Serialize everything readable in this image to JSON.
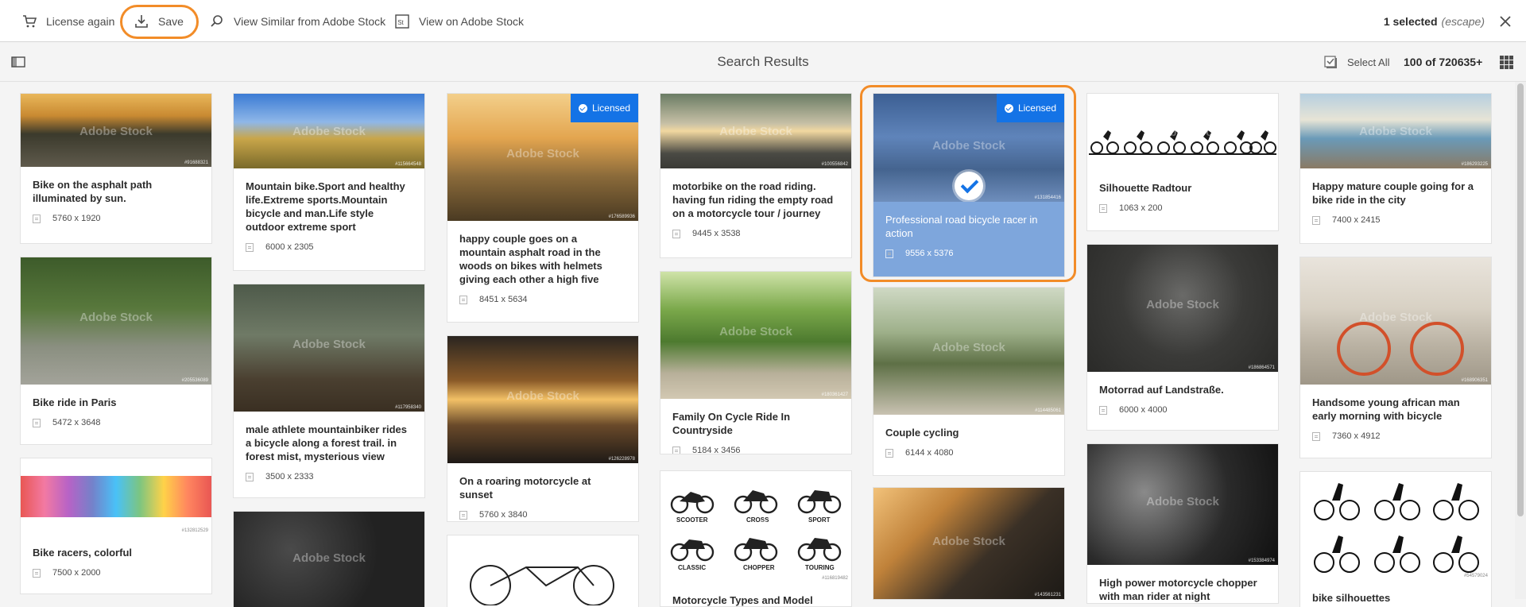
{
  "actions": {
    "license_again": "License again",
    "save": "Save",
    "view_similar": "View Similar from Adobe Stock",
    "view_on_stock": "View on Adobe Stock"
  },
  "selection": {
    "count_label": "1 selected",
    "hint": "(escape)"
  },
  "titlebar": {
    "title": "Search Results",
    "select_all": "Select All",
    "count": "100 of 720635+"
  },
  "watermark": "Adobe Stock",
  "licensed_label": "Licensed",
  "colors": {
    "accent": "#1473e6",
    "highlight": "#f28c28",
    "selected_card": "#7ea6dc"
  },
  "cards": [
    {
      "title": "Bike on the asphalt path illuminated by sun.",
      "size": "5760 x 1920",
      "id": "#91688321",
      "licensed": false,
      "selected": false
    },
    {
      "title": "Bike ride in Paris",
      "size": "5472 x 3648",
      "id": "#205536089",
      "licensed": false,
      "selected": false
    },
    {
      "title": "Bike racers, colorful",
      "size": "7500 x 2000",
      "id": "#132812529",
      "licensed": false,
      "selected": false
    },
    {
      "title": "Mountain bike.Sport and healthy life.Extreme sports.Mountain bicycle and man.Life style outdoor extreme sport",
      "size": "6000 x 2305",
      "id": "#115664548",
      "licensed": false,
      "selected": false
    },
    {
      "title": "male athlete mountainbiker rides a bicycle along a forest trail. in forest mist, mysterious view",
      "size": "3500 x 2333",
      "id": "#117958340",
      "licensed": false,
      "selected": false
    },
    {
      "title": "",
      "size": "",
      "id": "",
      "licensed": false,
      "selected": false
    },
    {
      "title": "happy couple goes on a mountain asphalt road in the woods on bikes with helmets giving each other a high five",
      "size": "8451 x 5634",
      "id": "#176589936",
      "licensed": true,
      "selected": false
    },
    {
      "title": "On a roaring motorcycle at sunset",
      "size": "5760 x 3840",
      "id": "#126228978",
      "licensed": false,
      "selected": false
    },
    {
      "title": "",
      "size": "",
      "id": "",
      "licensed": false,
      "selected": false
    },
    {
      "title": "motorbike on the road riding. having fun riding the empty road on a motorcycle tour / journey",
      "size": "9445 x 3538",
      "id": "#100556842",
      "licensed": false,
      "selected": false
    },
    {
      "title": "Family On Cycle Ride In Countryside",
      "size": "5184 x 3456",
      "id": "#180361427",
      "licensed": false,
      "selected": false
    },
    {
      "title": "Motorcycle Types and Model Objects",
      "size": "",
      "id": "#116819482",
      "licensed": false,
      "selected": false
    },
    {
      "title": "Professional road bicycle racer in action",
      "size": "9556 x 5376",
      "id": "#131854416",
      "licensed": true,
      "selected": true
    },
    {
      "title": "Couple cycling",
      "size": "6144 x 4080",
      "id": "#114485061",
      "licensed": false,
      "selected": false
    },
    {
      "title": "",
      "size": "",
      "id": "#143561231",
      "licensed": false,
      "selected": false
    },
    {
      "title": "Silhouette Radtour",
      "size": "1063 x 200",
      "id": "",
      "licensed": false,
      "selected": false
    },
    {
      "title": "Motorrad auf Landstraße.",
      "size": "6000 x 4000",
      "id": "#186864571",
      "licensed": false,
      "selected": false
    },
    {
      "title": "High power motorcycle chopper with man rider at night",
      "size": "",
      "id": "#153384974",
      "licensed": false,
      "selected": false
    },
    {
      "title": "Happy mature couple going for a bike ride in the city",
      "size": "7400 x 2415",
      "id": "#186293225",
      "licensed": false,
      "selected": false
    },
    {
      "title": "Handsome young african man early morning with bicycle",
      "size": "7360 x 4912",
      "id": "#168906351",
      "licensed": false,
      "selected": false
    },
    {
      "title": "bike silhouettes",
      "size": "",
      "id": "#54579024",
      "licensed": false,
      "selected": false
    }
  ],
  "icons": {
    "left": "cart-icon",
    "save": "download-icon",
    "similar": "search-icon",
    "stock": "stock-icon",
    "close": "close-icon",
    "rail": "rail-toggle-icon",
    "selectall": "select-all-icon",
    "view": "grid-view-icon"
  }
}
